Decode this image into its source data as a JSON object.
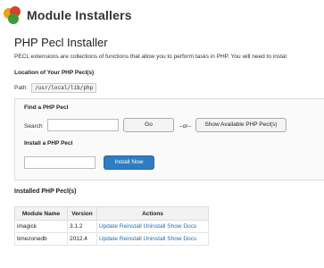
{
  "header": {
    "title": "Module Installers",
    "logo_icon": "module-installers-icon"
  },
  "page": {
    "title": "PHP Pecl Installer",
    "intro": "PECL extensions are collections of functions that allow you to perform tasks in PHP. You will need to instal"
  },
  "location": {
    "heading": "Location of Your PHP Pecl(s)",
    "path_label": "Path:",
    "path_value": "/usr/local/lib/php"
  },
  "find": {
    "heading": "Find a PHP Pecl",
    "search_label": "Search",
    "search_value": "",
    "go_label": "Go",
    "or_text": "–or–",
    "show_label": "Show Available PHP Pecl(s)"
  },
  "install": {
    "heading": "Install a PHP Pecl",
    "input_value": "",
    "button_label": "Install Now"
  },
  "installed": {
    "heading": "Installed PHP Pecl(s)",
    "columns": [
      "Module Name",
      "Version",
      "Actions"
    ],
    "rows": [
      {
        "name": "imagick",
        "version": "3.1.2",
        "actions": [
          "Update",
          "Reinstall",
          "Uninstall",
          "Show Docs"
        ]
      },
      {
        "name": "timezonedb",
        "version": "2012.4",
        "actions": [
          "Update",
          "Reinstall",
          "Uninstall",
          "Show Docs"
        ]
      }
    ]
  },
  "colors": {
    "accent": "#2f7dc1",
    "link": "#1e6eb8"
  }
}
